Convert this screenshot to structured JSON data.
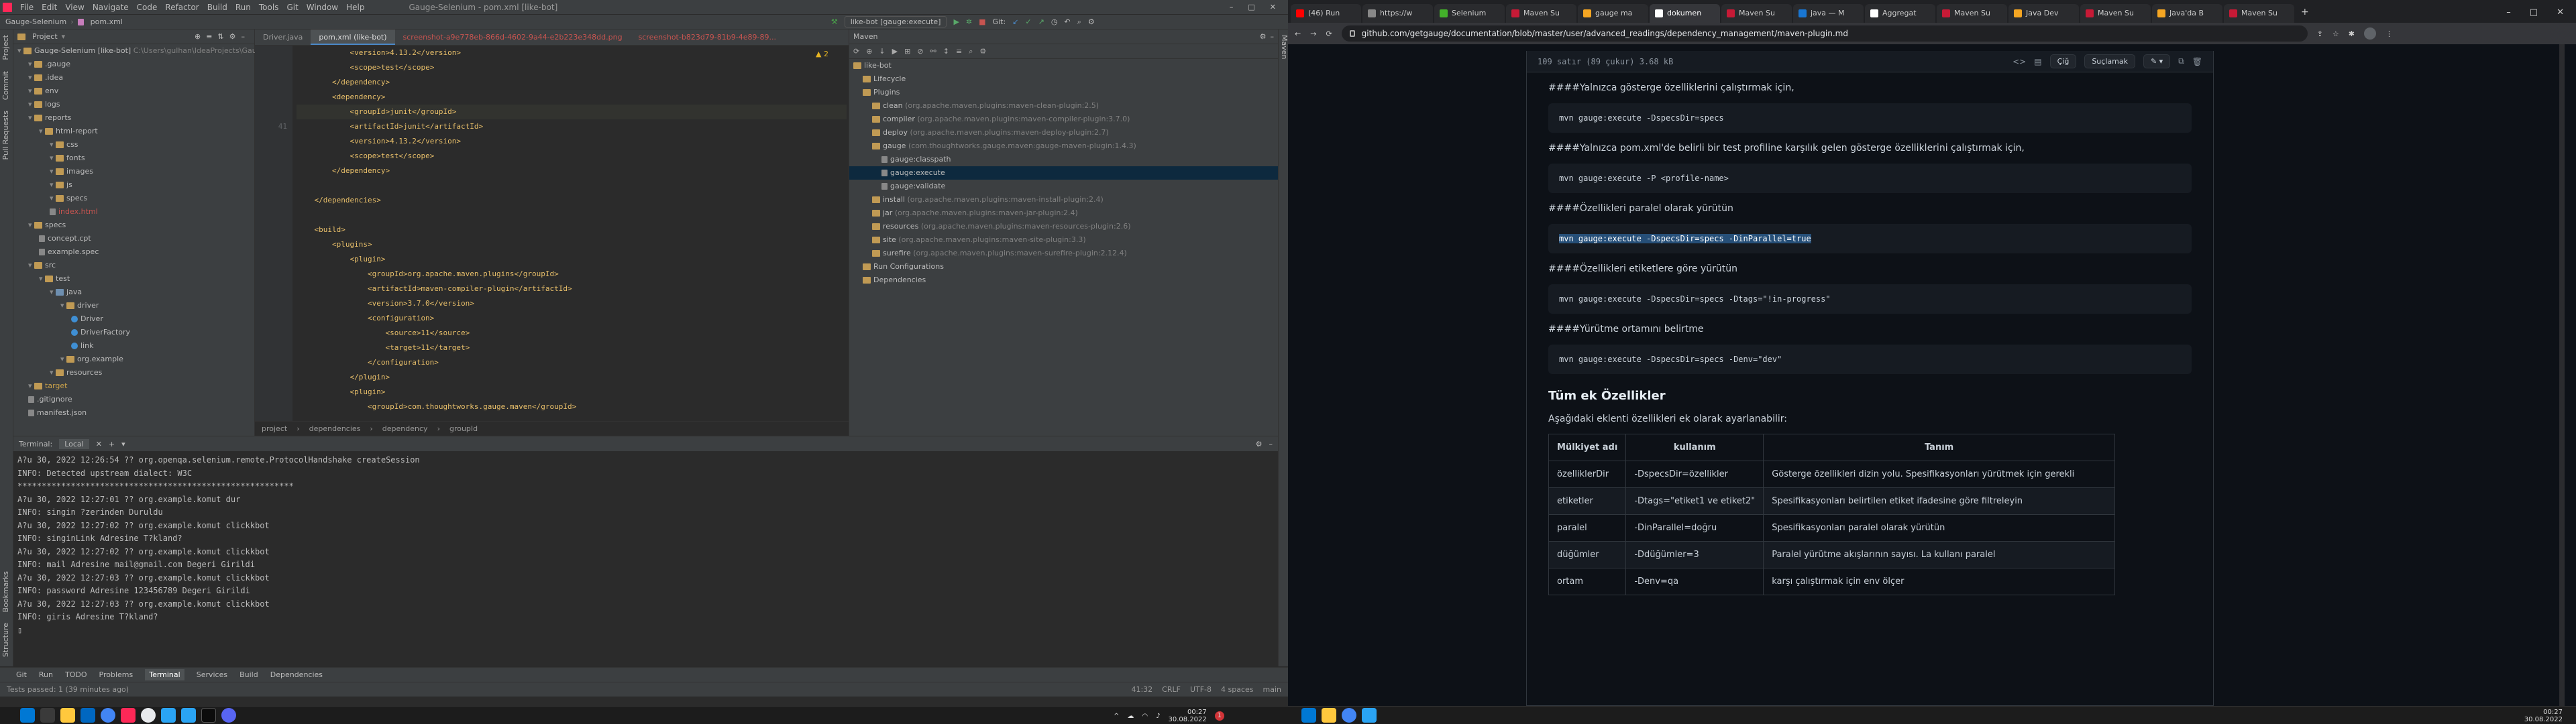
{
  "ide": {
    "menu": [
      "File",
      "Edit",
      "View",
      "Navigate",
      "Code",
      "Refactor",
      "Build",
      "Run",
      "Tools",
      "Git",
      "Window",
      "Help"
    ],
    "window_title": "Gauge-Selenium - pom.xml [like-bot]",
    "breadcrumb": [
      "Gauge-Selenium",
      "pom.xml"
    ],
    "run_config": "like-bot [gauge:execute]",
    "git_label": "Git:",
    "project_panel_title": "Project",
    "tree": [
      {
        "label": "Gauge-Selenium [like-bot]",
        "extra": "C:\\Users\\gulhan\\IdeaProjects\\Gauge-Selenium",
        "indent": 0,
        "icon": "folder"
      },
      {
        "label": ".gauge",
        "indent": 1,
        "icon": "folder"
      },
      {
        "label": ".idea",
        "indent": 1,
        "icon": "folder"
      },
      {
        "label": "env",
        "indent": 1,
        "icon": "folder"
      },
      {
        "label": "logs",
        "indent": 1,
        "icon": "folder"
      },
      {
        "label": "reports",
        "indent": 1,
        "icon": "folder"
      },
      {
        "label": "html-report",
        "indent": 2,
        "icon": "folder"
      },
      {
        "label": "css",
        "indent": 3,
        "icon": "folder"
      },
      {
        "label": "fonts",
        "indent": 3,
        "icon": "folder"
      },
      {
        "label": "images",
        "indent": 3,
        "icon": "folder"
      },
      {
        "label": "js",
        "indent": 3,
        "icon": "folder"
      },
      {
        "label": "specs",
        "indent": 3,
        "icon": "folder"
      },
      {
        "label": "index.html",
        "indent": 3,
        "icon": "file"
      },
      {
        "label": "specs",
        "indent": 1,
        "icon": "folder"
      },
      {
        "label": "concept.cpt",
        "indent": 2,
        "icon": "file"
      },
      {
        "label": "example.spec",
        "indent": 2,
        "icon": "file"
      },
      {
        "label": "src",
        "indent": 1,
        "icon": "folder"
      },
      {
        "label": "test",
        "indent": 2,
        "icon": "folder"
      },
      {
        "label": "java",
        "indent": 3,
        "icon": "ofolder"
      },
      {
        "label": "driver",
        "indent": 4,
        "icon": "folder"
      },
      {
        "label": "Driver",
        "indent": 5,
        "icon": "jfile"
      },
      {
        "label": "DriverFactory",
        "indent": 5,
        "icon": "jfile"
      },
      {
        "label": "link",
        "indent": 5,
        "icon": "jfile"
      },
      {
        "label": "org.example",
        "indent": 4,
        "icon": "folder"
      },
      {
        "label": "resources",
        "indent": 3,
        "icon": "folder"
      },
      {
        "label": "target",
        "indent": 1,
        "icon": "folder"
      },
      {
        "label": ".gitignore",
        "indent": 1,
        "icon": "file"
      },
      {
        "label": "manifest.json",
        "indent": 1,
        "icon": "file"
      }
    ],
    "editor_tabs": [
      {
        "label": "Driver.java",
        "active": false,
        "red": false
      },
      {
        "label": "pom.xml (like-bot)",
        "active": true,
        "red": false
      },
      {
        "label": "screenshot-a9e778eb-866d-4602-9a44-e2b223e348dd.png",
        "active": false,
        "red": true
      },
      {
        "label": "screenshot-b823d79-81b9-4e89-89...",
        "active": false,
        "red": true
      }
    ],
    "line_numbers": [
      "",
      "",
      "",
      "",
      "",
      "41",
      "",
      "",
      "",
      "",
      "",
      "",
      "",
      "",
      "",
      "",
      "",
      "",
      "",
      "",
      "",
      "",
      "",
      "",
      ""
    ],
    "code_lines": [
      {
        "indent": "            ",
        "text": "<version>4.13.2</version>"
      },
      {
        "indent": "            ",
        "text": "<scope>test</scope>"
      },
      {
        "indent": "        ",
        "text": "</dependency>"
      },
      {
        "indent": "        ",
        "text": "<dependency>"
      },
      {
        "indent": "            ",
        "text": "<groupId>junit</groupId>"
      },
      {
        "indent": "            ",
        "text": "<artifactId>junit</artifactId>"
      },
      {
        "indent": "            ",
        "text": "<version>4.13.2</version>"
      },
      {
        "indent": "            ",
        "text": "<scope>test</scope>"
      },
      {
        "indent": "        ",
        "text": "</dependency>"
      },
      {
        "indent": "",
        "text": ""
      },
      {
        "indent": "    ",
        "text": "</dependencies>"
      },
      {
        "indent": "",
        "text": ""
      },
      {
        "indent": "    ",
        "text": "<build>"
      },
      {
        "indent": "        ",
        "text": "<plugins>"
      },
      {
        "indent": "            ",
        "text": "<plugin>"
      },
      {
        "indent": "                ",
        "text": "<groupId>org.apache.maven.plugins</groupId>"
      },
      {
        "indent": "                ",
        "text": "<artifactId>maven-compiler-plugin</artifactId>"
      },
      {
        "indent": "                ",
        "text": "<version>3.7.0</version>"
      },
      {
        "indent": "                ",
        "text": "<configuration>"
      },
      {
        "indent": "                    ",
        "text": "<source>11</source>"
      },
      {
        "indent": "                    ",
        "text": "<target>11</target>"
      },
      {
        "indent": "                ",
        "text": "</configuration>"
      },
      {
        "indent": "            ",
        "text": "</plugin>"
      },
      {
        "indent": "            ",
        "text": "<plugin>"
      },
      {
        "indent": "                ",
        "text": "<groupId>com.thoughtworks.gauge.maven</groupId>"
      }
    ],
    "editor_crumbs": [
      "project",
      "dependencies",
      "dependency",
      "groupId"
    ],
    "problems_badge": "▲ 2",
    "maven_title": "Maven",
    "maven_tree": [
      {
        "label": "like-bot",
        "extra": "",
        "indent": 0,
        "selected": false
      },
      {
        "label": "Lifecycle",
        "extra": "",
        "indent": 1,
        "selected": false
      },
      {
        "label": "Plugins",
        "extra": "",
        "indent": 1,
        "selected": false
      },
      {
        "label": "clean",
        "extra": "(org.apache.maven.plugins:maven-clean-plugin:2.5)",
        "indent": 2,
        "selected": false
      },
      {
        "label": "compiler",
        "extra": "(org.apache.maven.plugins:maven-compiler-plugin:3.7.0)",
        "indent": 2,
        "selected": false
      },
      {
        "label": "deploy",
        "extra": "(org.apache.maven.plugins:maven-deploy-plugin:2.7)",
        "indent": 2,
        "selected": false
      },
      {
        "label": "gauge",
        "extra": "(com.thoughtworks.gauge.maven:gauge-maven-plugin:1.4.3)",
        "indent": 2,
        "selected": false
      },
      {
        "label": "gauge:classpath",
        "extra": "",
        "indent": 3,
        "selected": false
      },
      {
        "label": "gauge:execute",
        "extra": "",
        "indent": 3,
        "selected": true
      },
      {
        "label": "gauge:validate",
        "extra": "",
        "indent": 3,
        "selected": false
      },
      {
        "label": "install",
        "extra": "(org.apache.maven.plugins:maven-install-plugin:2.4)",
        "indent": 2,
        "selected": false
      },
      {
        "label": "jar",
        "extra": "(org.apache.maven.plugins:maven-jar-plugin:2.4)",
        "indent": 2,
        "selected": false
      },
      {
        "label": "resources",
        "extra": "(org.apache.maven.plugins:maven-resources-plugin:2.6)",
        "indent": 2,
        "selected": false
      },
      {
        "label": "site",
        "extra": "(org.apache.maven.plugins:maven-site-plugin:3.3)",
        "indent": 2,
        "selected": false
      },
      {
        "label": "surefire",
        "extra": "(org.apache.maven.plugins:maven-surefire-plugin:2.12.4)",
        "indent": 2,
        "selected": false
      },
      {
        "label": "Run Configurations",
        "extra": "",
        "indent": 1,
        "selected": false
      },
      {
        "label": "Dependencies",
        "extra": "",
        "indent": 1,
        "selected": false
      }
    ],
    "terminal_title": "Terminal:",
    "terminal_tab": "Local",
    "terminal_lines": [
      "A?u 30, 2022 12:26:54 ?? org.openqa.selenium.remote.ProtocolHandshake createSession",
      "INFO: Detected upstream dialect: W3C",
      "*********************************************************",
      "A?u 30, 2022 12:27:01 ?? org.example.komut dur",
      "INFO: singin ?zerinden Duruldu",
      "A?u 30, 2022 12:27:02 ?? org.example.komut clickkbot",
      "INFO: singinLink Adresine T?kland?",
      "A?u 30, 2022 12:27:02 ?? org.example.komut clickkbot",
      "INFO: mail Adresine mail@gmail.com Degeri Girildi",
      "A?u 30, 2022 12:27:03 ?? org.example.komut clickkbot",
      "INFO: password Adresine 123456789 Degeri Girildi",
      "A?u 30, 2022 12:27:03 ?? org.example.komut clickkbot",
      "INFO: giris Adresine T?kland?"
    ],
    "bottom_tabs": [
      "Git",
      "Run",
      "TODO",
      "Problems",
      "Terminal",
      "Services",
      "Build",
      "Dependencies"
    ],
    "status_left": "Tests passed: 1 (39 minutes ago)",
    "status_right": [
      "41:32",
      "CRLF",
      "UTF-8",
      "4 spaces",
      "main"
    ],
    "left_stripe": [
      "Project",
      "Commit",
      "Pull Requests"
    ],
    "left_stripe_bottom": [
      "Bookmarks",
      "Structure"
    ],
    "right_stripe": [
      "Maven"
    ]
  },
  "browser": {
    "tabs": [
      {
        "label": "(46) Run",
        "color": "#ff0000",
        "active": false
      },
      {
        "label": "https://w",
        "color": "#888888",
        "active": false
      },
      {
        "label": "Selenium",
        "color": "#43b02a",
        "active": false
      },
      {
        "label": "Maven Su",
        "color": "#c71a36",
        "active": false
      },
      {
        "label": "gauge ma",
        "color": "#f5a623",
        "active": false
      },
      {
        "label": "dokumen",
        "color": "#ffffff",
        "active": true
      },
      {
        "label": "Maven Su",
        "color": "#c71a36",
        "active": false
      },
      {
        "label": "java — M",
        "color": "#1976d2",
        "active": false
      },
      {
        "label": "Aggregat",
        "color": "#ffffff",
        "active": false
      },
      {
        "label": "Maven Su",
        "color": "#c71a36",
        "active": false
      },
      {
        "label": "Java Dev",
        "color": "#f5a623",
        "active": false
      },
      {
        "label": "Maven Su",
        "color": "#c71a36",
        "active": false
      },
      {
        "label": "Java'da B",
        "color": "#f5a623",
        "active": false
      },
      {
        "label": "Maven Su",
        "color": "#c71a36",
        "active": false
      }
    ],
    "url": "github.com/getgauge/documentation/blob/master/user/advanced_readings/dependency_management/maven-plugin.md",
    "file_info": "109 satır (89 çukur)    3.68 kB",
    "btn_raw": "Çiğ",
    "btn_blame": "Suçlamak",
    "sections": [
      {
        "heading": "####Yalnızca gösterge özelliklerini çalıştırmak için,",
        "code": "mvn gauge:execute -DspecsDir=specs",
        "highlight": false
      },
      {
        "heading": "####Yalnızca pom.xml'de belirli bir test profiline karşılık gelen gösterge özelliklerini çalıştırmak için,",
        "code": "mvn gauge:execute -P <profile-name>",
        "highlight": false
      },
      {
        "heading": "####Özellikleri paralel olarak yürütün",
        "code": "mvn gauge:execute -DspecsDir=specs -DinParallel=true",
        "highlight": true
      },
      {
        "heading": "####Özellikleri etiketlere göre yürütün",
        "code": "mvn gauge:execute -DspecsDir=specs -Dtags=\"!in-progress\"",
        "highlight": false
      },
      {
        "heading": "####Yürütme ortamını belirtme",
        "code": "mvn gauge:execute -DspecsDir=specs -Denv=\"dev\"",
        "highlight": false
      }
    ],
    "all_props_title": "Tüm ek Özellikler",
    "all_props_desc": "Aşağıdaki eklenti özellikleri ek olarak ayarlanabilir:",
    "table_headers": [
      "Mülkiyet adı",
      "kullanım",
      "Tanım"
    ],
    "table_rows": [
      [
        "özelliklerDir",
        "-DspecsDir=özellikler",
        "Gösterge özellikleri dizin yolu. Spesifikasyonları yürütmek için gerekli"
      ],
      [
        "etiketler",
        "-Dtags=\"etiket1 ve etiket2\"",
        "Spesifikasyonları belirtilen etiket ifadesine göre filtreleyin"
      ],
      [
        "paralel",
        "-DinParallel=doğru",
        "Spesifikasyonları paralel olarak yürütün"
      ],
      [
        "düğümler",
        "-Ddüğümler=3",
        "Paralel yürütme akışlarının sayısı. La kullanı paralel"
      ],
      [
        "ortam",
        "-Denv=qa",
        "karşı çalıştırmak için env ölçer"
      ]
    ]
  },
  "taskbar": {
    "left_time": "00:27",
    "left_date": "30.08.2022",
    "right_time": "00:27",
    "right_date": "30.08.2022",
    "badge": "1"
  }
}
